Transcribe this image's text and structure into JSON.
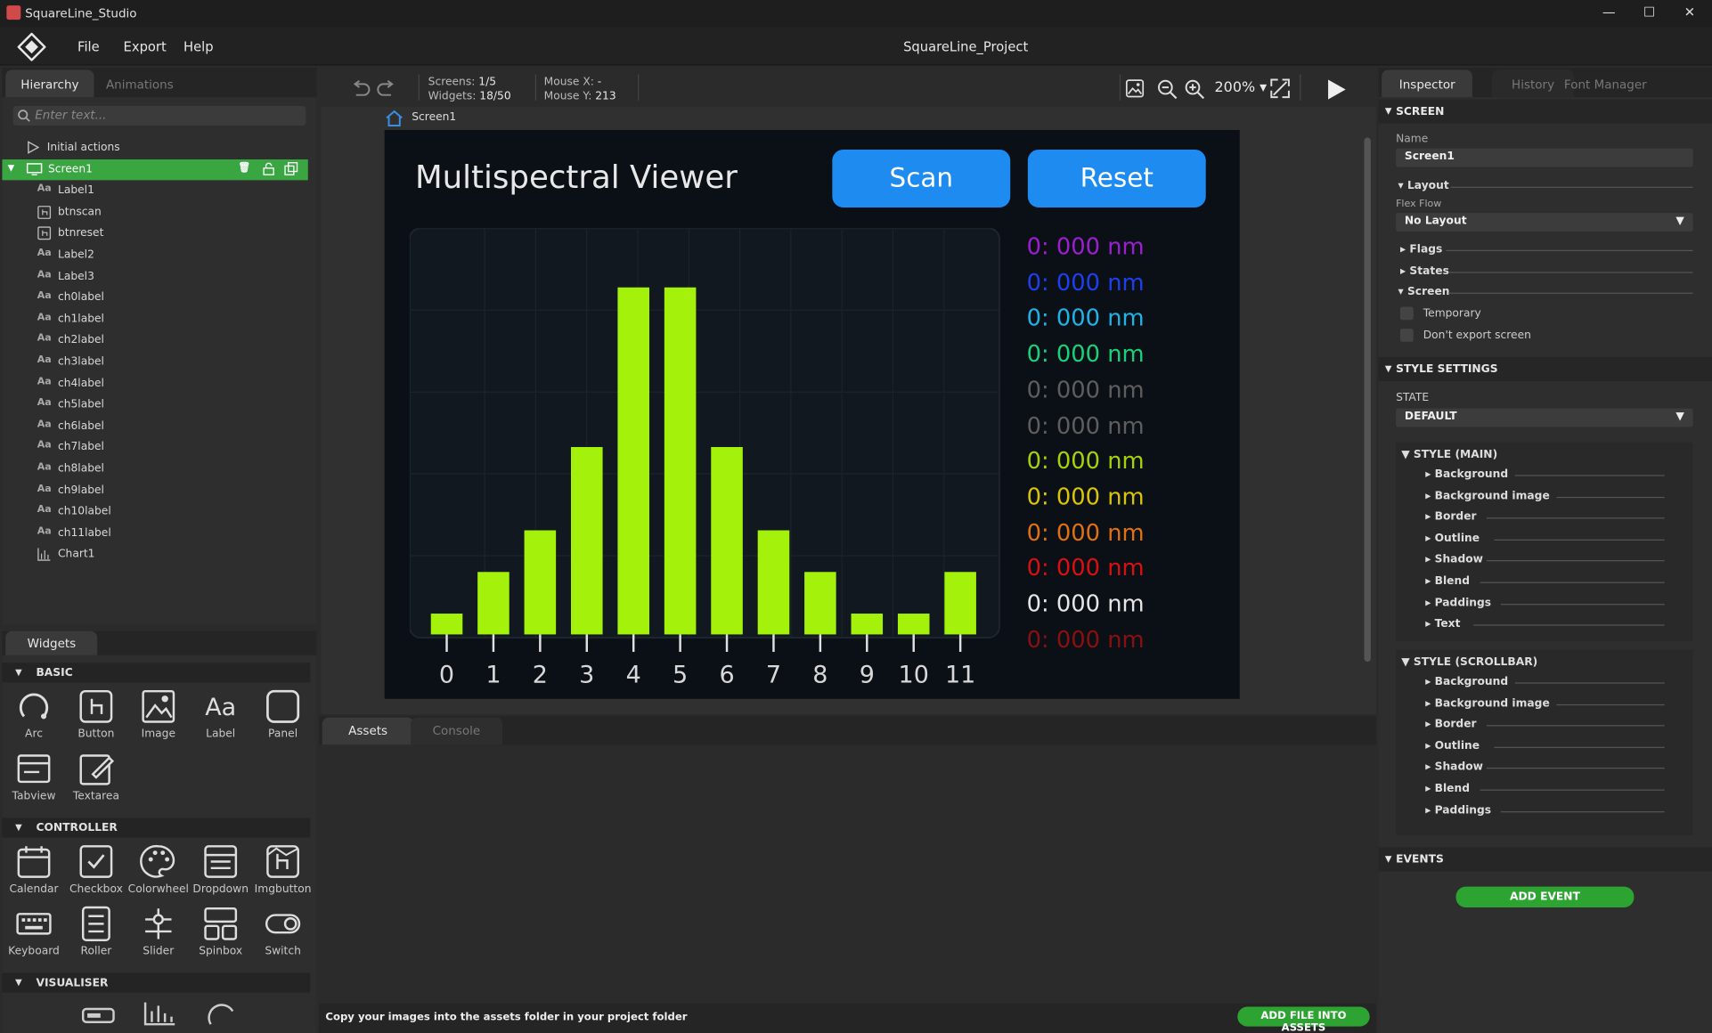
{
  "titlebar": {
    "title": "SquareLine_Studio",
    "min": "—",
    "max": "☐",
    "close": "✕"
  },
  "menubar": {
    "items": [
      "File",
      "Export",
      "Help"
    ],
    "project": "SquareLine_Project"
  },
  "hierarchy": {
    "tabs": [
      "Hierarchy",
      "Animations"
    ],
    "search_placeholder": "Enter text...",
    "items": [
      {
        "label": "Initial actions",
        "icon": "play-icon"
      },
      {
        "label": "Screen1",
        "icon": "screen-icon"
      },
      {
        "label": "Label1",
        "icon": "label-icon"
      },
      {
        "label": "btnscan",
        "icon": "button-icon"
      },
      {
        "label": "btnreset",
        "icon": "button-icon"
      },
      {
        "label": "Label2",
        "icon": "label-icon"
      },
      {
        "label": "Label3",
        "icon": "label-icon"
      },
      {
        "label": "ch0label",
        "icon": "label-icon"
      },
      {
        "label": "ch1label",
        "icon": "label-icon"
      },
      {
        "label": "ch2label",
        "icon": "label-icon"
      },
      {
        "label": "ch3label",
        "icon": "label-icon"
      },
      {
        "label": "ch4label",
        "icon": "label-icon"
      },
      {
        "label": "ch5label",
        "icon": "label-icon"
      },
      {
        "label": "ch6label",
        "icon": "label-icon"
      },
      {
        "label": "ch7label",
        "icon": "label-icon"
      },
      {
        "label": "ch8label",
        "icon": "label-icon"
      },
      {
        "label": "ch9label",
        "icon": "label-icon"
      },
      {
        "label": "ch10label",
        "icon": "label-icon"
      },
      {
        "label": "ch11label",
        "icon": "label-icon"
      },
      {
        "label": "Chart1",
        "icon": "chart-icon"
      }
    ],
    "label_glyph": "Aa"
  },
  "widgets": {
    "tab": "Widgets",
    "sections": {
      "basic": "BASIC",
      "controller": "CONTROLLER",
      "visualiser": "VISUALISER"
    },
    "basic": [
      "Arc",
      "Button",
      "Image",
      "Label",
      "Panel",
      "Tabview",
      "Textarea"
    ],
    "controller": [
      "Calendar",
      "Checkbox",
      "Colorwheel",
      "Dropdown",
      "Imgbutton",
      "Keyboard",
      "Roller",
      "Slider",
      "Spinbox",
      "Switch"
    ]
  },
  "toolbar": {
    "screens_label": "Screens:",
    "screens_value": "1/5",
    "widgets_label": "Widgets:",
    "widgets_value": "18/50",
    "mousex_label": "Mouse X:",
    "mousex_value": "-",
    "mousey_label": "Mouse Y:",
    "mousey_value": "213",
    "zoom": "200%",
    "breadcrumb": "Screen1"
  },
  "screen": {
    "title": "Multispectral Viewer",
    "scan": "Scan",
    "reset": "Reset",
    "channels": [
      {
        "text": "0: 000 nm",
        "color": "#9b1fd1"
      },
      {
        "text": "0: 000 nm",
        "color": "#1e3ff0"
      },
      {
        "text": "0: 000 nm",
        "color": "#1fb3e8"
      },
      {
        "text": "0: 000 nm",
        "color": "#1ad17a"
      },
      {
        "text": "0: 000 nm",
        "color": "#5e5e5e"
      },
      {
        "text": "0: 000 nm",
        "color": "#5e5e5e"
      },
      {
        "text": "0: 000 nm",
        "color": "#a6d10a"
      },
      {
        "text": "0: 000 nm",
        "color": "#d9c40a"
      },
      {
        "text": "0: 000 nm",
        "color": "#e07010"
      },
      {
        "text": "0: 000 nm",
        "color": "#d91010"
      },
      {
        "text": "0: 000 nm",
        "color": "#e6e6e6"
      },
      {
        "text": "0: 000 nm",
        "color": "#8a1010"
      }
    ],
    "accent": "#1e8bf0",
    "bar_color": "#a4f20c"
  },
  "chart_data": {
    "type": "bar",
    "categories": [
      "0",
      "1",
      "2",
      "3",
      "4",
      "5",
      "6",
      "7",
      "8",
      "9",
      "10",
      "11"
    ],
    "values": [
      6,
      18,
      30,
      54,
      100,
      100,
      54,
      30,
      18,
      6,
      6,
      18
    ],
    "ylim": [
      0,
      118
    ],
    "grid": true
  },
  "bottom": {
    "tabs": [
      "Assets",
      "Console"
    ],
    "hint": "Copy your images into the assets folder in your project folder",
    "add_file": "ADD FILE INTO ASSETS"
  },
  "inspector": {
    "tabs": [
      "Inspector",
      "History",
      "Font Manager"
    ],
    "screen_section": "SCREEN",
    "name_label": "Name",
    "name_value": "Screen1",
    "layout": "Layout",
    "flexflow_label": "Flex Flow",
    "flexflow_value": "No Layout",
    "flags": "Flags",
    "states": "States",
    "screen_sub": "Screen",
    "temporary": "Temporary",
    "dont_export": "Don't export screen",
    "style_settings": "STYLE SETTINGS",
    "state_label": "STATE",
    "state_value": "DEFAULT",
    "style_main": "STYLE (MAIN)",
    "style_main_items": [
      "Background",
      "Background image",
      "Border",
      "Outline",
      "Shadow",
      "Blend",
      "Paddings",
      "Text"
    ],
    "style_scroll": "STYLE (SCROLLBAR)",
    "style_scroll_items": [
      "Background",
      "Background image",
      "Border",
      "Outline",
      "Shadow",
      "Blend",
      "Paddings"
    ],
    "events": "EVENTS",
    "add_event": "ADD EVENT"
  }
}
